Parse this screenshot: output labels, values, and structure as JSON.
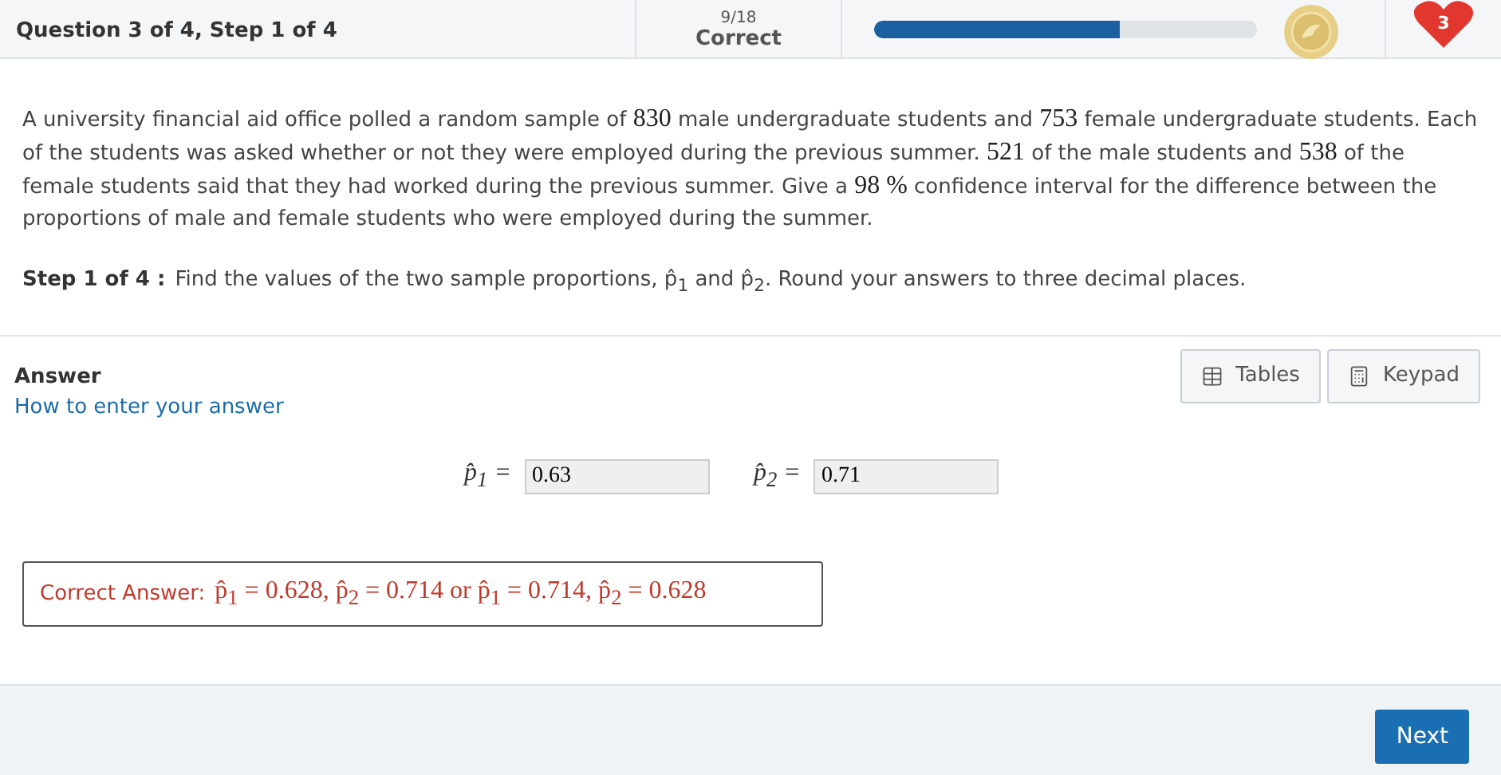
{
  "header": {
    "title": "Question 3 of 4, Step 1 of 4",
    "score": "9/18",
    "score_label": "Correct",
    "progress": {
      "level": 0.64
    },
    "lives": "3"
  },
  "question": {
    "text": "A university financial aid office polled a random sample of **830** male undergraduate students and **753** female undergraduate students. Each of the students was asked whether or not they were employed during the previous summer.  **521** of the male students and **538** of the female students said that they had worked during the previous summer.  Give a **98 %**  confidence interval for the difference between the proportions of male and female students who were employed during the summer.",
    "step_label": "Step 1 of 4 :",
    "step_text": "Find the values of the two sample proportions, p̂$_{1}$ and p̂$_{2}$. Round your answers to three decimal places."
  },
  "answer": {
    "title": "Answer",
    "help_link": "How to enter your answer",
    "buttons": [
      {
        "kind": "table",
        "label": "Tables"
      },
      {
        "kind": "keypad",
        "label": "Keypad"
      }
    ],
    "fields": [
      {
        "label": "p̂$_{1}$ =",
        "value": "0.63"
      },
      {
        "label": "p̂$_{2}$ =",
        "value": "0.71"
      }
    ],
    "correct_answer": {
      "label": "Correct Answer:",
      "text": "p̂$_{1}$ = 0.628, p̂$_{2}$ = 0.714 or p̂$_{1}$ = 0.714, p̂$_{2}$ = 0.628"
    }
  },
  "footer": {
    "next": "Next"
  }
}
